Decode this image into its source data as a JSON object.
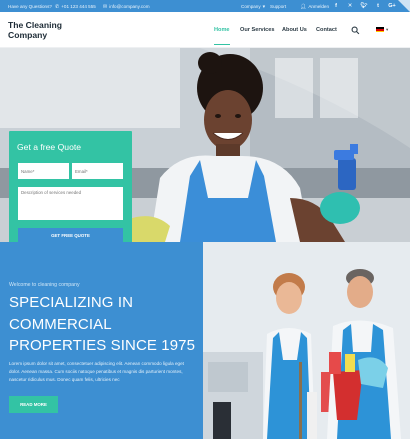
{
  "topbar": {
    "question": "Have any Questions?",
    "phone": "+01 123 444 555",
    "email": "info@company.com",
    "company_menu": "Company",
    "support": "Support",
    "login": "Anmelden",
    "social_icons": [
      "facebook-icon",
      "x-icon",
      "twitter-icon",
      "tumblr-icon",
      "google-plus-icon"
    ]
  },
  "header": {
    "logo_line1": "The Cleaning",
    "logo_line2": "Company",
    "nav": [
      "Home",
      "Our Services",
      "About Us",
      "Contact"
    ],
    "active_nav": "Home",
    "language": "de"
  },
  "quote_form": {
    "title": "Get a free Quote",
    "name_placeholder": "Name*",
    "email_placeholder": "Email*",
    "description_placeholder": "Description of services needed",
    "submit_label": "GET FREE QUOTE"
  },
  "intro": {
    "welcome": "Welcome to cleaning company",
    "headline_lines": [
      "SPECIALIZING IN",
      "COMMERCIAL",
      "PROPERTIES SINCE 1975"
    ],
    "body": "Lorem ipsum dolor sit amet, consectetuer adipiscing elit. Aenean commodo ligula eget dolor. Aenean massa. Cum sociis natoque penatibus et magnis dis parturient montes, nascetur ridiculus mus. Donec quam felis, ultricies nec",
    "button_label": "READ MORE"
  },
  "colors": {
    "primary_blue": "#3d8fd2",
    "accent_green": "#33c3a4",
    "dark_text": "#1d2b36"
  }
}
